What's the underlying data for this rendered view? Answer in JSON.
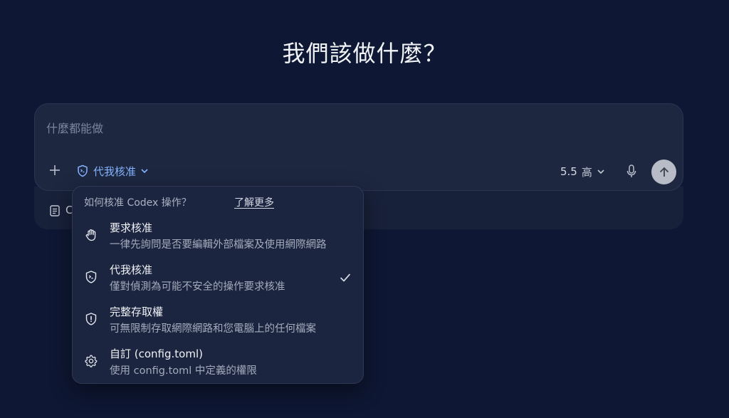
{
  "page": {
    "title": "我們該做什麼？"
  },
  "composer": {
    "placeholder": "什麼都能做",
    "approval_label": "代我核准",
    "model_version": "5.5",
    "effort_level": "高",
    "peek_text": "C"
  },
  "approval_menu": {
    "heading": "如何核准 Codex 操作？",
    "learn_more": "了解更多",
    "options": [
      {
        "name": "要求核准",
        "desc": "一律先詢問是否要編輯外部檔案及使用網際網路",
        "icon": "hand-icon",
        "selected": false
      },
      {
        "name": "代我核准",
        "desc": "僅對偵測為可能不安全的操作要求核准",
        "icon": "shield-terminal-icon",
        "selected": true
      },
      {
        "name": "完整存取權",
        "desc": "可無限制存取網際網路和您電腦上的任何檔案",
        "icon": "shield-alert-icon",
        "selected": false
      },
      {
        "name": "自訂 (config.toml)",
        "desc": "使用 config.toml 中定義的權限",
        "icon": "gear-icon",
        "selected": false
      }
    ]
  },
  "colors": {
    "background": "#0e1733",
    "accent": "#86b4ff",
    "panel": "#1d2740"
  }
}
